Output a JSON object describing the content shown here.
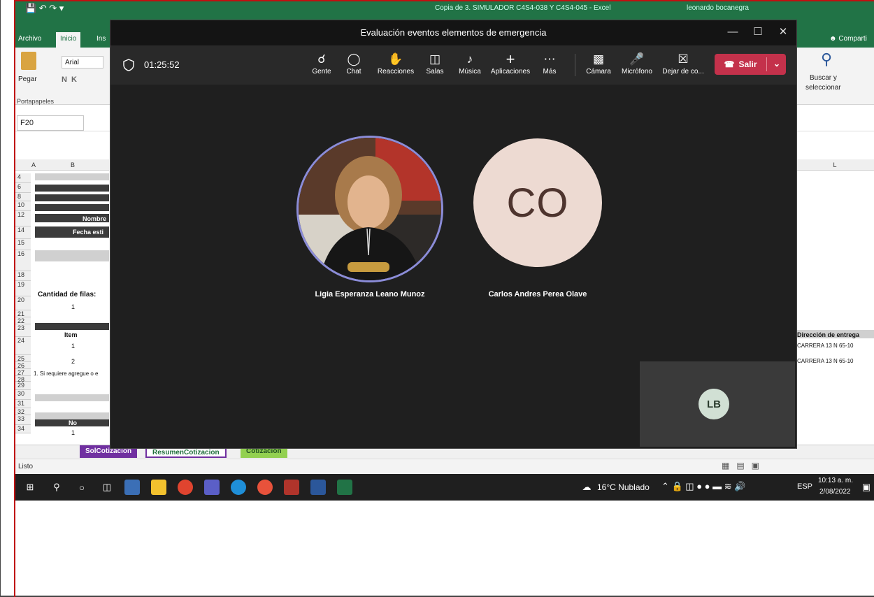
{
  "excel": {
    "window_title": "Copia de 3. SIMULADOR C4S4-038 Y C4S4-045  -  Excel",
    "user": "leonardo bocanegra",
    "tabs": [
      "Archivo",
      "Inicio",
      "Ins"
    ],
    "share_label": "Comparti",
    "font_name": "Arial",
    "paste_label": "Pegar",
    "clipboard_group": "Portapapeles",
    "find_label_1": "Buscar y",
    "find_label_2": "seleccionar",
    "name_box": "F20",
    "col_a": "A",
    "col_b": "B",
    "col_l": "L",
    "row_numbers": [
      "4",
      "6",
      "8",
      "10",
      "12",
      "14",
      "15",
      "16",
      "18",
      "19",
      "20",
      "21",
      "22",
      "23",
      "24",
      "25",
      "26",
      "27",
      "28",
      "29",
      "30",
      "31",
      "32",
      "33",
      "34"
    ],
    "nombre_label": "Nombre",
    "fecha_label": "Fecha esti",
    "cantidad_label": "Cantidad de filas:",
    "cantidad_value": "1",
    "item_header": "Item",
    "item_1": "1",
    "item_2": "2",
    "note": "1. Si requiere agregue o e",
    "no_header": "No",
    "no_1": "1",
    "direccion_header": "Dirección de entrega",
    "direccion_1": "CARRERA 13 N 65-10",
    "direccion_2": "CARRERA 13 N 65-10",
    "sheet_tabs": [
      "SolCotizacion",
      "ResumenCotizacion",
      "Cotizacion"
    ],
    "status": "Listo"
  },
  "teams": {
    "title": "Evaluación eventos elementos de emergencia",
    "timer": "01:25:52",
    "toolbar": [
      {
        "label": "Gente",
        "icon": "people-icon"
      },
      {
        "label": "Chat",
        "icon": "chat-icon"
      },
      {
        "label": "Reacciones",
        "icon": "reactions-icon"
      },
      {
        "label": "Salas",
        "icon": "rooms-icon"
      },
      {
        "label": "Música",
        "icon": "music-icon"
      },
      {
        "label": "Aplicaciones",
        "icon": "plus-icon"
      },
      {
        "label": "Más",
        "icon": "more-icon"
      }
    ],
    "camera_label": "Cámara",
    "mic_label": "Micrófono",
    "stop_share_label": "Dejar de co...",
    "leave_label": "Salir",
    "participants": [
      {
        "name": "Ligia Esperanza Leano Munoz"
      },
      {
        "name": "Carlos Andres Perea Olave",
        "initials": "CO"
      }
    ],
    "self_initials": "LB"
  },
  "taskbar": {
    "weather": "16°C  Nublado",
    "language": "ESP",
    "time": "10:13 a. m.",
    "date": "2/08/2022"
  }
}
